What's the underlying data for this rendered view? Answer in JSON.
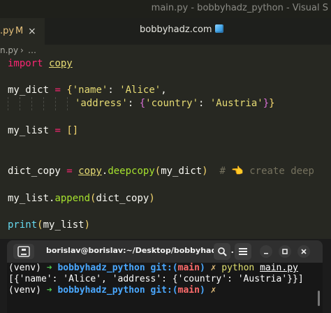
{
  "window": {
    "title": "main.py - bobbyhadz_python - Visual S"
  },
  "tabs": [
    {
      "label": ".py",
      "modified": "M",
      "close": "×"
    }
  ],
  "banner": {
    "text": "bobbyhadz.com"
  },
  "breadcrumb": {
    "file": "n.py",
    "sep": "›",
    "more": "…"
  },
  "code": {
    "l1_kw": "import",
    "l1_mod": "copy",
    "l2_var": "my_dict",
    "l2_op": " = ",
    "l2_brace": "{",
    "l2_k1": "'name'",
    "l2_colon": ": ",
    "l2_v1": "'Alice'",
    "l2_comma": ",",
    "l3_k2": "'address'",
    "l3_colon": ": ",
    "l3_brace": "{",
    "l3_k3": "'country'",
    "l3_colon2": ": ",
    "l3_v3": "'Austria'",
    "l3_close1": "}",
    "l3_close2": "}",
    "l4_var": "my_list",
    "l4_op": " = ",
    "l4_val": "[]",
    "l5_var": "dict_copy",
    "l5_op": " = ",
    "l5_mod": "copy",
    "l5_dot": ".",
    "l5_fn": "deepcopy",
    "l5_p1": "(",
    "l5_arg": "my_dict",
    "l5_p2": ")",
    "l5_cmt": "  # 👈 create deep",
    "l6_var": "my_list",
    "l6_dot": ".",
    "l6_fn": "append",
    "l6_p1": "(",
    "l6_arg": "dict_copy",
    "l6_p2": ")",
    "l7_fn": "print",
    "l7_p1": "(",
    "l7_arg": "my_list",
    "l7_p2": ")"
  },
  "terminal": {
    "title": "borislav@borislav:~/Desktop/bobbyhadz_...",
    "line1": {
      "venv": "(venv) ",
      "arrow": "➜ ",
      "dir": "bobbyhadz_python",
      "git": " git:(",
      "branch": "main",
      "git_close": ")",
      "x": " ✗",
      "cmd": " python ",
      "file": "main.py"
    },
    "line2": "[{'name': 'Alice', 'address': {'country': 'Austria'}}]",
    "line3": {
      "venv": "(venv) ",
      "arrow": "➜ ",
      "dir": "bobbyhadz_python",
      "git": " git:(",
      "branch": "main",
      "git_close": ")",
      "x": " ✗"
    }
  },
  "icons": [
    "terminal-icon",
    "search-icon",
    "menu-icon",
    "minimize-icon",
    "maximize-icon",
    "close-icon",
    "cube-icon"
  ],
  "colors": {
    "editor_bg": "#272822",
    "keyword": "#f92672",
    "string": "#e6db74",
    "function": "#a6e22e",
    "builtin": "#66d9ef",
    "terminal_bg": "#171717"
  }
}
